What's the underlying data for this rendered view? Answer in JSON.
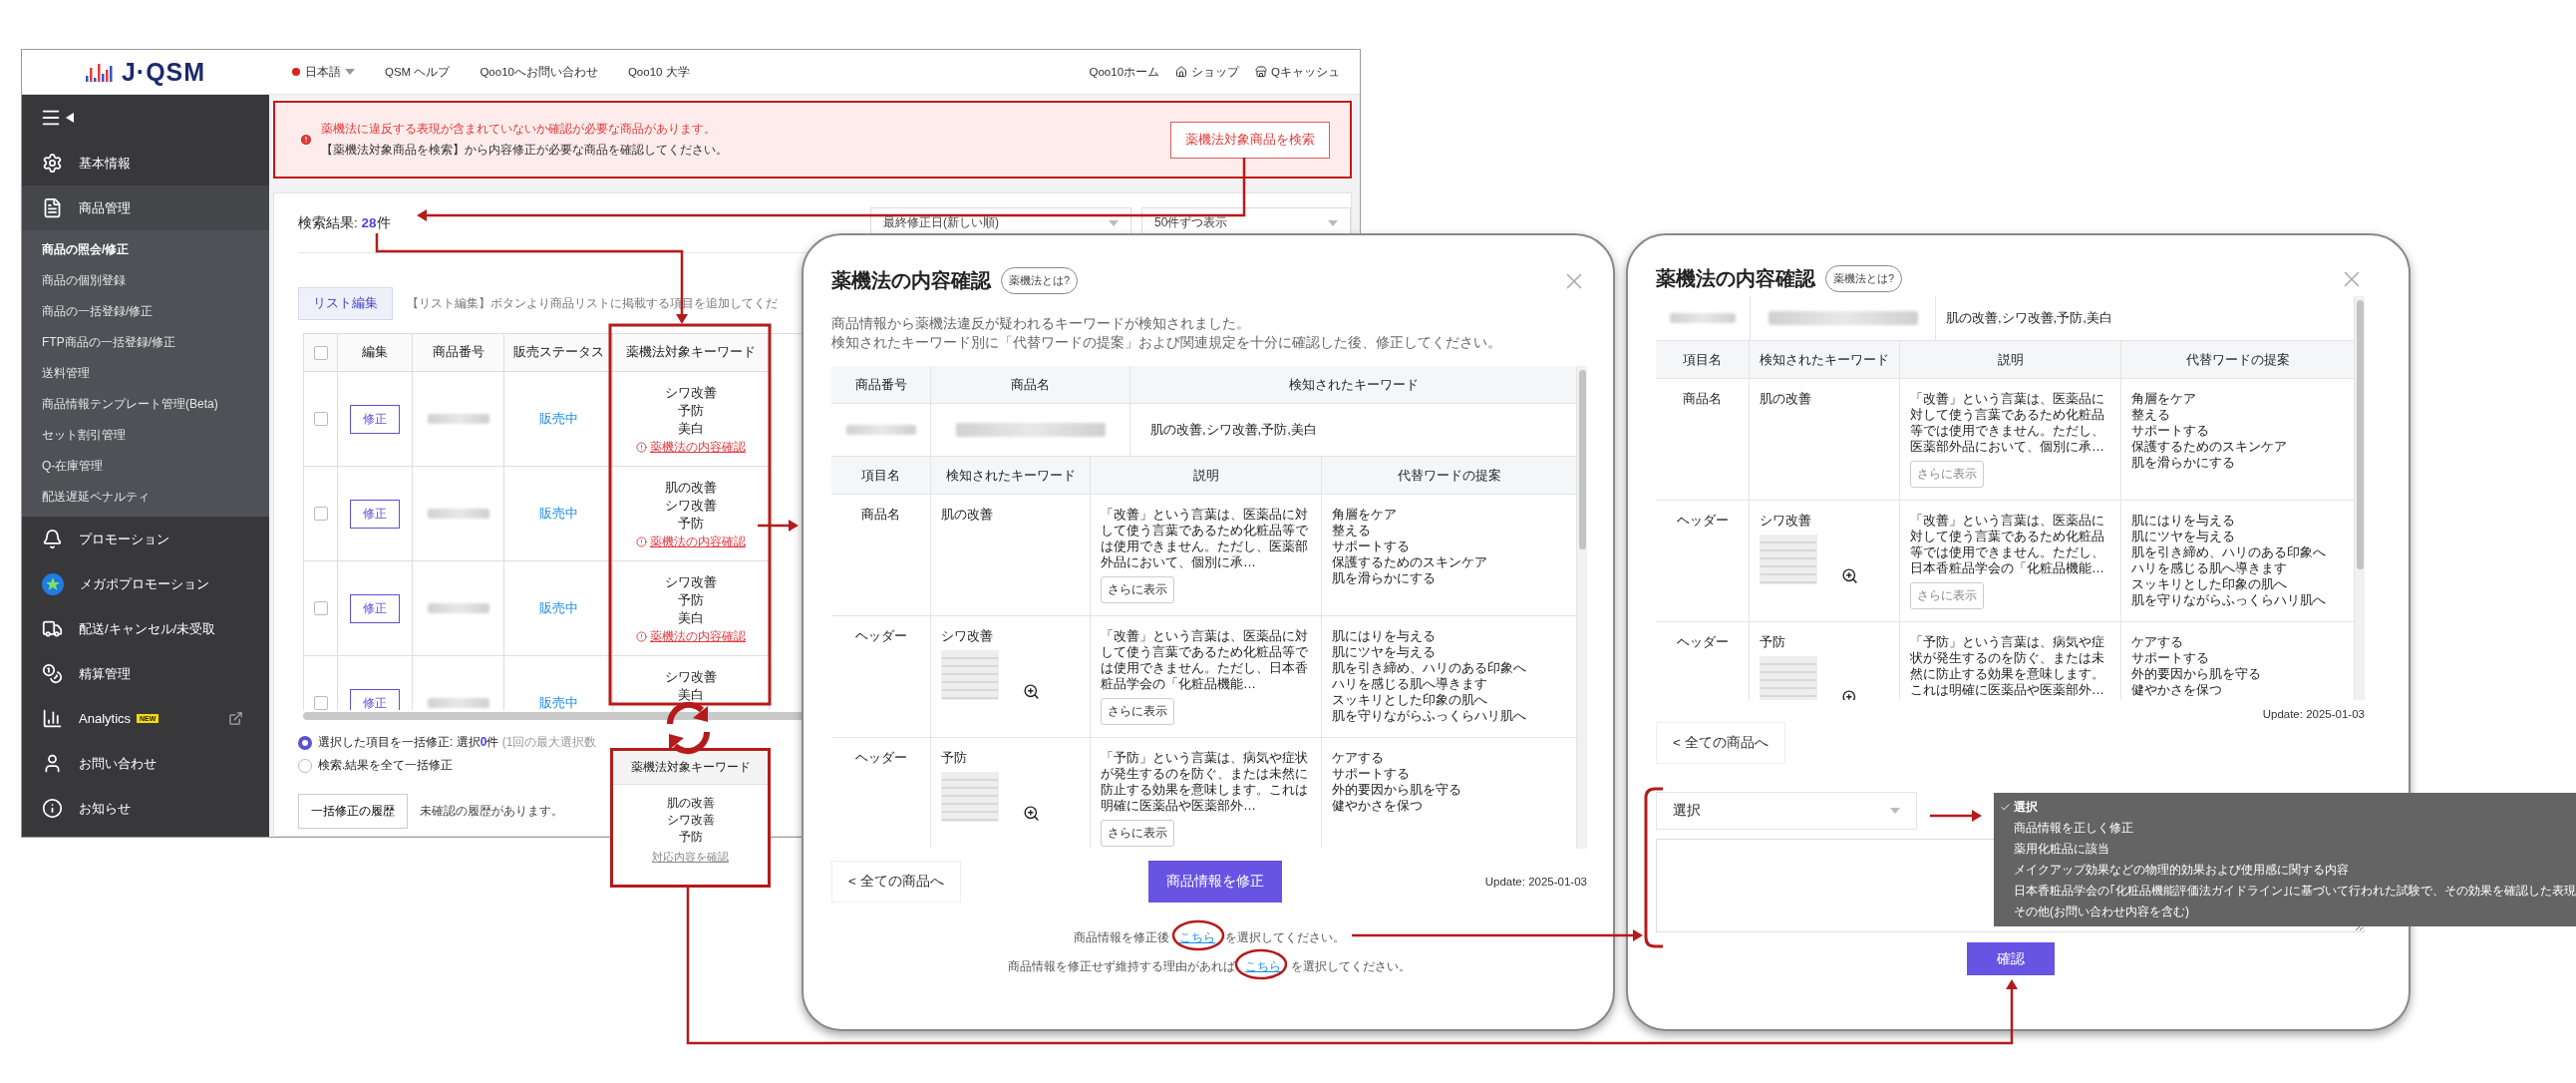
{
  "app": {
    "logo": "J·QSM",
    "header": {
      "language": "日本語",
      "links": [
        "QSM ヘルプ",
        "Qoo10へお問い合わせ",
        "Qoo10 大学"
      ],
      "right_links": [
        "Qoo10ホーム",
        "ショップ",
        "Qキャッシュ"
      ]
    },
    "sidebar": {
      "items": [
        {
          "label": "基本情報",
          "expanded": false
        },
        {
          "label": "商品管理",
          "expanded": true,
          "children": [
            {
              "label": "商品の照会/修正",
              "selected": true
            },
            {
              "label": "商品の個別登録",
              "selected": false
            },
            {
              "label": "商品の一括登録/修正",
              "selected": false
            },
            {
              "label": "FTP商品の一括登録/修正",
              "selected": false
            },
            {
              "label": "送料管理",
              "selected": false
            },
            {
              "label": "商品情報テンプレート管理(Beta)",
              "selected": false
            },
            {
              "label": "セット割引管理",
              "selected": false
            },
            {
              "label": "Q-在庫管理",
              "selected": false
            },
            {
              "label": "配送遅延ペナルティ",
              "selected": false
            }
          ]
        },
        {
          "label": "プロモーション",
          "expanded": false
        },
        {
          "label": "メガポプロモーション",
          "expanded": false
        },
        {
          "label": "配送/キャンセル/未受取",
          "expanded": false
        },
        {
          "label": "精算管理",
          "expanded": false
        },
        {
          "label": "Analytics",
          "expanded": false,
          "badge": "NEW"
        },
        {
          "label": "お問い合わせ",
          "expanded": false
        },
        {
          "label": "お知らせ",
          "expanded": false
        }
      ]
    },
    "alert": {
      "lines": [
        "薬機法に違反する表現が含まれていないか確認が必要な商品があります。",
        "【薬機法対象商品を検索】から内容修正が必要な商品を確認してください。"
      ],
      "button": "薬機法対象商品を検索"
    },
    "results": {
      "label": "検索結果: ",
      "count": "28",
      "unit": "件"
    },
    "sort_selects": [
      "最終修正日(新しい順)",
      "50件ずつ表示"
    ],
    "list_edit": {
      "button": "リスト編集",
      "hint": "【リスト編集】ボタンより商品リストに掲載する項目を追加してくだ"
    },
    "table": {
      "all_checked": false,
      "columns": [
        "編集",
        "商品番号",
        "販売ステータス",
        "薬機法対象キーワード"
      ],
      "rows": [
        {
          "checked": false,
          "edit": "修正",
          "status": "販売中",
          "keywords": [
            "シワ改善",
            "予防",
            "美白"
          ],
          "link": "薬機法の内容確認"
        },
        {
          "checked": false,
          "edit": "修正",
          "status": "販売中",
          "keywords": [
            "肌の改善",
            "シワ改善",
            "予防"
          ],
          "link": "薬機法の内容確認"
        },
        {
          "checked": false,
          "edit": "修正",
          "status": "販売中",
          "keywords": [
            "シワ改善",
            "予防",
            "美白"
          ],
          "link": "薬機法の内容確認"
        },
        {
          "checked": false,
          "edit": "修正",
          "status": "販売中",
          "keywords": [
            "シワ改善",
            "美白"
          ]
        }
      ]
    },
    "bulk": {
      "options": [
        {
          "label": "選択した項目を一括修正: 選択",
          "count": "0",
          "unit": "件",
          "note": "(1回の最大選択数",
          "selected": true
        },
        {
          "label": "検索.結果を全て一括修正",
          "selected": false
        }
      ]
    },
    "history": {
      "button": "一括修正の履歴",
      "note": "未確認の履歴があります。"
    }
  },
  "keyword_popout": {
    "header": "薬機法対象キーワード",
    "keywords": [
      "肌の改善",
      "シワ改善",
      "予防"
    ],
    "link": "対応内容を確認"
  },
  "check_modal": {
    "title": "薬機法の内容確認",
    "help": "薬機法とは?",
    "description": [
      "商品情報から薬機法違反が疑われるキーワードが検知されました。",
      "検知されたキーワード別に「代替ワードの提案」および関連規定を十分に確認した後、修正してください。"
    ],
    "product_table": {
      "columns": [
        "商品番号",
        "商品名",
        "検知されたキーワード"
      ],
      "keywords": "肌の改善,シワ改善,予防,美白"
    },
    "detail_table": {
      "columns": [
        "項目名",
        "検知されたキーワード",
        "説明",
        "代替ワードの提案"
      ],
      "rows": [
        {
          "item": "商品名",
          "keyword": "肌の改善",
          "thumbnail": false,
          "text": "「改善」という言葉は、医薬品に対して使う言葉であるため化粧品等では使用できません。ただし、医薬部外品において、個別に承…",
          "more": "さらに表示",
          "suggestions": [
            "角層をケア",
            "整える",
            "サポートする",
            "保護するためのスキンケア",
            "肌を滑らかにする"
          ]
        },
        {
          "item": "ヘッダー",
          "keyword": "シワ改善",
          "thumbnail": true,
          "text": "「改善」という言葉は、医薬品に対して使う言葉であるため化粧品等では使用できません。ただし、日本香粧品学会の「化粧品機能…",
          "more": "さらに表示",
          "suggestions": [
            "肌にはりを与える",
            "肌にツヤを与える",
            "肌を引き締め、ハリのある印象へ",
            "ハリを感じる肌へ導きます",
            "スッキリとした印象の肌へ",
            "肌を守りながらふっくらハリ肌へ"
          ]
        },
        {
          "item": "ヘッダー",
          "keyword": "予防",
          "thumbnail": true,
          "text": "「予防」という言葉は、病気や症状が発生するのを防ぐ、または未然に防止する効果を意味します。これは明確に医薬品や医薬部外…",
          "more": "さらに表示",
          "suggestions": [
            "ケアする",
            "サポートする",
            "外的要因から肌を守る",
            "健やかさを保つ"
          ]
        }
      ]
    },
    "back_button": "< 全ての商品へ",
    "primary_button": "商品情報を修正",
    "update": "Update: 2025-01-03",
    "link_lines": [
      {
        "before": "商品情報を修正後",
        "link": "こちら",
        "after": "を選択してください。"
      },
      {
        "before": "商品情報を修正せず維持する理由があれば",
        "link": "こちら",
        "after": "を選択してください。"
      }
    ]
  },
  "reason_modal": {
    "title": "薬機法の内容確認",
    "help": "薬機法とは?",
    "product_keywords": "肌の改善,シワ改善,予防,美白",
    "detail_table": {
      "columns": [
        "項目名",
        "検知されたキーワード",
        "説明",
        "代替ワードの提案"
      ],
      "rows": [
        {
          "item": "商品名",
          "keyword": "肌の改善",
          "thumbnail": false,
          "text": "「改善」という言葉は、医薬品に対して使う言葉であるため化粧品等では使用できません。ただし、医薬部外品において、個別に承…",
          "more": "さらに表示",
          "suggestions": [
            "角層をケア",
            "整える",
            "サポートする",
            "保護するためのスキンケア",
            "肌を滑らかにする"
          ]
        },
        {
          "item": "ヘッダー",
          "keyword": "シワ改善",
          "thumbnail": true,
          "text": "「改善」という言葉は、医薬品に対して使う言葉であるため化粧品等では使用できません。ただし、日本香粧品学会の「化粧品機能…",
          "more": "さらに表示",
          "suggestions": [
            "肌にはりを与える",
            "肌にツヤを与える",
            "肌を引き締め、ハリのある印象へ",
            "ハリを感じる肌へ導きます",
            "スッキリとした印象の肌へ",
            "肌を守りながらふっくらハリ肌へ"
          ]
        },
        {
          "item": "ヘッダー",
          "keyword": "予防",
          "thumbnail": true,
          "text": "「予防」という言葉は、病気や症状が発生するのを防ぐ、または未然に防止する効果を意味します。これは明確に医薬品や医薬部外…",
          "suggestions": [
            "ケアする",
            "サポートする",
            "外的要因から肌を守る",
            "健やかさを保つ"
          ]
        }
      ]
    },
    "update": "Update: 2025-01-03",
    "back_button": "< 全ての商品へ",
    "select": "選択",
    "confirm_button": "確認"
  },
  "reason_menu": {
    "options": [
      {
        "label": "選択",
        "selected": true
      },
      {
        "label": "商品情報を正しく修正",
        "selected": false
      },
      {
        "label": "薬用化粧品に該当",
        "selected": false
      },
      {
        "label": "メイクアップ効果などの物理的効果および使用感に関する内容",
        "selected": false
      },
      {
        "label": "日本香粧品学会の｢化粧品機能評価法ガイドライン｣に基づいて行われた試験で、その効果を確認した表現",
        "selected": false
      },
      {
        "label": "その他(お問い合わせ内容を含む)",
        "selected": false
      }
    ]
  }
}
